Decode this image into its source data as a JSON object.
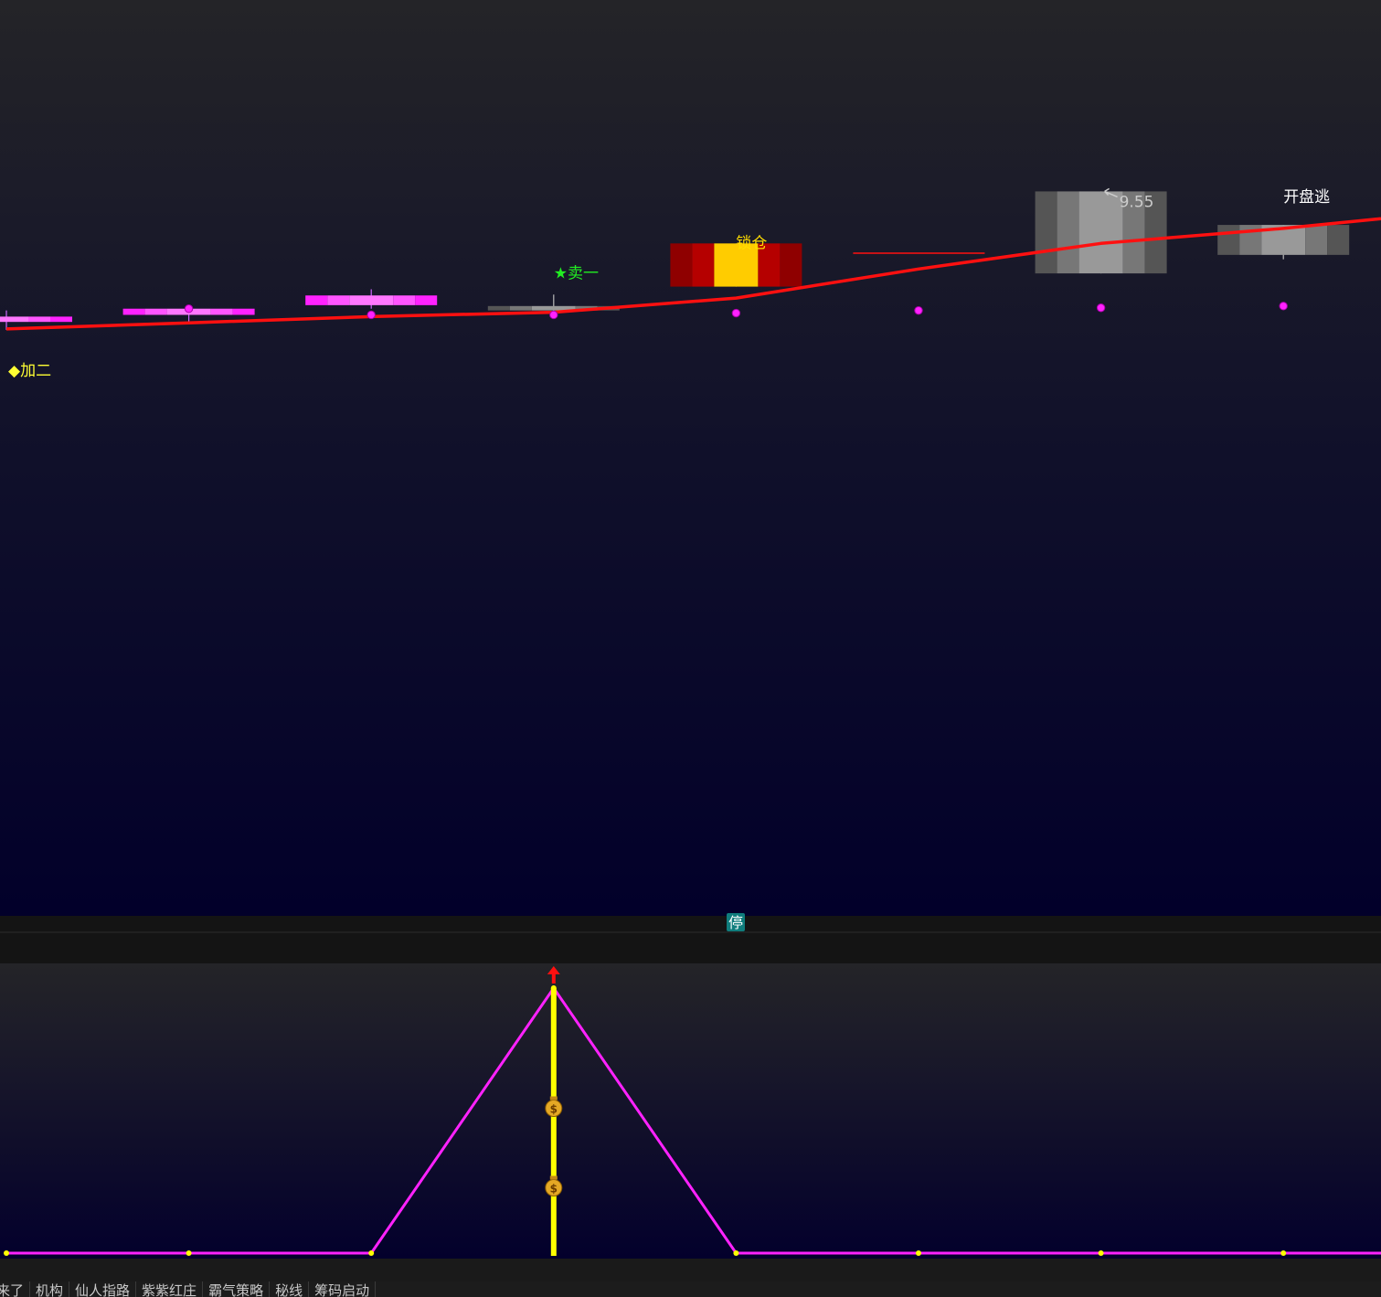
{
  "colors": {
    "ma_line": "#ff1010",
    "bullish": "#ff33ff",
    "neutral": "#9a9a9a",
    "limit_up": "#b00000",
    "limit_up_core": "#ffcc00",
    "signal_yellow": "#ffff33",
    "signal_green": "#22ee22",
    "indicator_line": "#ff22ff",
    "indicator_bar": "#ffff00"
  },
  "stop_badge": "停",
  "chart_data": [
    {
      "type": "candlestick",
      "title": "",
      "candles": [
        {
          "open": 8.07,
          "close": 8.13,
          "high": 8.2,
          "low": 7.98,
          "style": "bullish"
        },
        {
          "open": 8.15,
          "close": 8.22,
          "high": 8.25,
          "low": 8.06,
          "style": "bullish"
        },
        {
          "open": 8.26,
          "close": 8.37,
          "high": 8.44,
          "low": 8.22,
          "style": "bullish"
        },
        {
          "open": 8.2,
          "close": 8.25,
          "high": 8.38,
          "low": 8.17,
          "style": "neutral"
        },
        {
          "open": 8.47,
          "close": 8.96,
          "high": 8.96,
          "low": 8.47,
          "style": "limit_up"
        },
        {
          "open": null,
          "close": null,
          "high": null,
          "low": null,
          "style": "none"
        },
        {
          "open": 9.55,
          "close": 8.62,
          "high": 9.55,
          "low": 8.62,
          "style": "neutral"
        },
        {
          "open": 9.17,
          "close": 8.83,
          "high": 9.17,
          "low": 8.78,
          "style": "neutral"
        }
      ],
      "ma_line": [
        7.99,
        8.06,
        8.13,
        8.18,
        8.34,
        8.67,
        8.96,
        9.13,
        9.24
      ],
      "dots": [
        8.22,
        8.15,
        8.15,
        8.17,
        8.2,
        8.23,
        8.25
      ],
      "ref_line": 8.85,
      "annotations": [
        {
          "text": "◆加二",
          "index": 0,
          "color": "#ffff33"
        },
        {
          "text": "★卖一",
          "index": 3,
          "color": "#22ee22"
        },
        {
          "text": "锁仓",
          "index": 4,
          "color": "#ffdd00"
        },
        {
          "text": "9.55",
          "index": 6,
          "color": "#cccccc"
        },
        {
          "text": "开盘逃",
          "index": 7,
          "color": "#ffffff"
        }
      ]
    },
    {
      "type": "line",
      "title": "",
      "values": [
        0,
        0,
        0,
        1,
        0,
        0,
        0,
        0
      ],
      "bar_index": 3,
      "markers": [
        {
          "icon": "money-bag-icon",
          "symbol": "$"
        },
        {
          "icon": "money-bag-icon",
          "symbol": "$"
        }
      ],
      "arrow_icon": "up-arrow-icon"
    }
  ],
  "tabs": [
    "来了",
    "机构",
    "仙人指路",
    "紫紫红庄",
    "霸气策略",
    "秘线",
    "筹码启动"
  ]
}
